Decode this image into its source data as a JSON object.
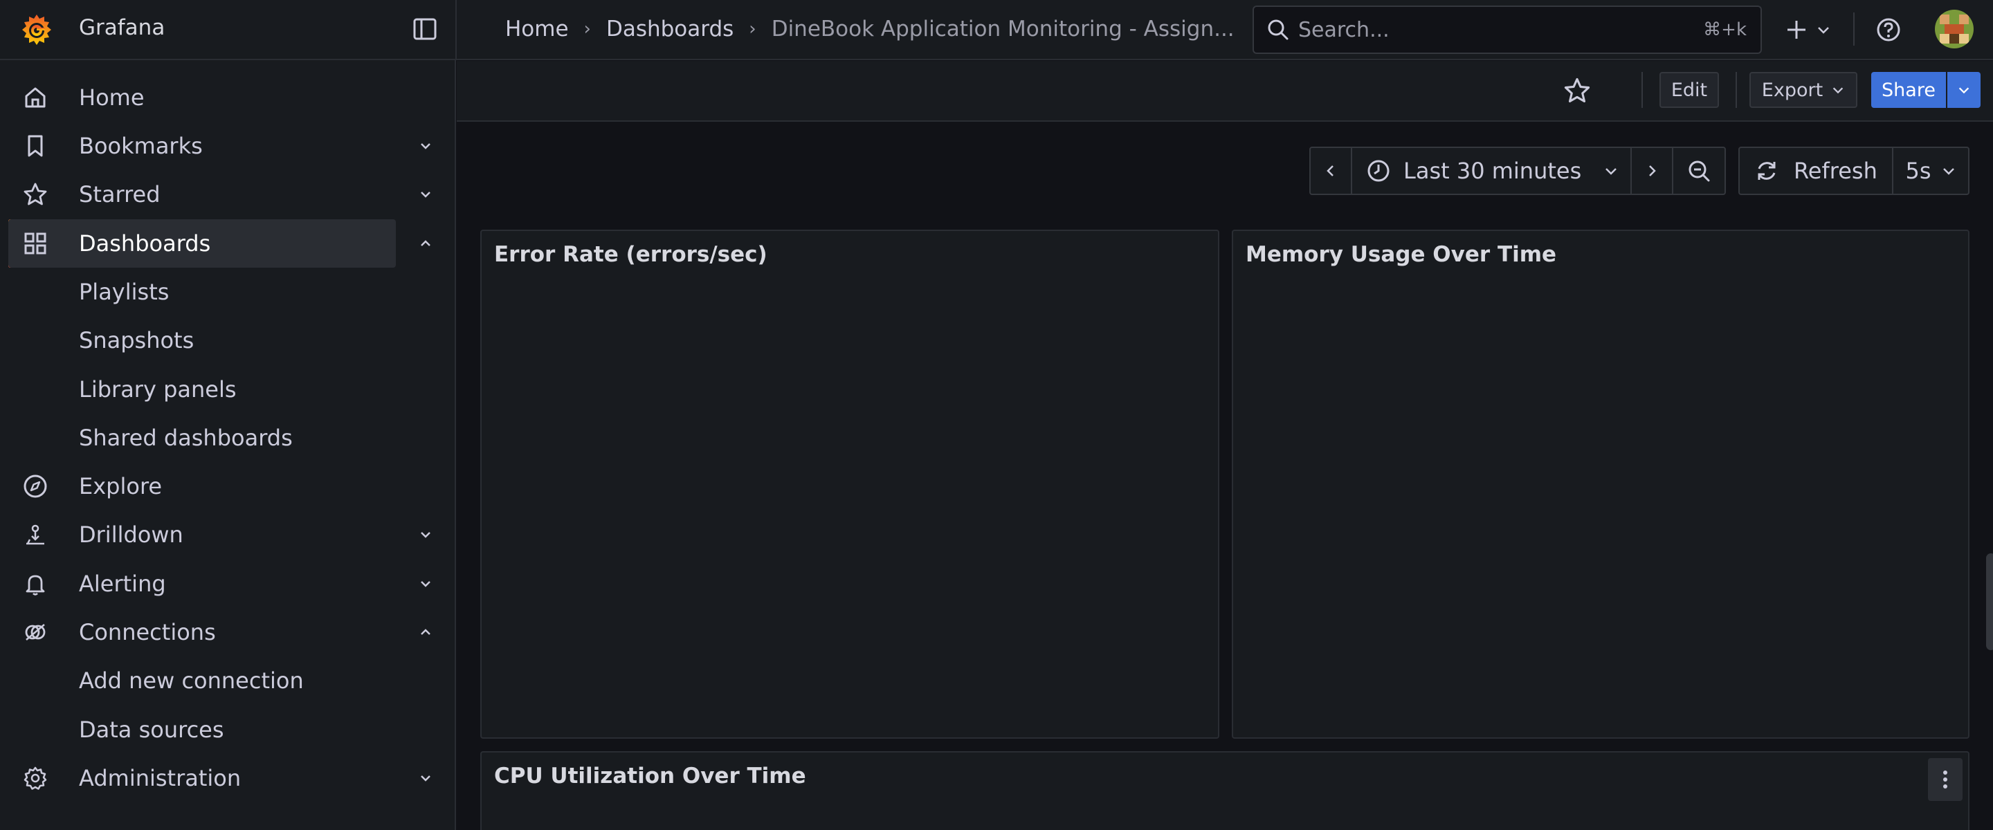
{
  "app": {
    "name": "Grafana"
  },
  "breadcrumb": {
    "items": [
      "Home",
      "Dashboards",
      "DineBook Application Monitoring - Assign..."
    ]
  },
  "search": {
    "placeholder": "Search...",
    "shortcut": "⌘+k"
  },
  "sidebar": {
    "items": [
      {
        "label": "Home",
        "icon": "home-icon",
        "chevron": "none"
      },
      {
        "label": "Bookmarks",
        "icon": "bookmark-icon",
        "chevron": "down"
      },
      {
        "label": "Starred",
        "icon": "star-icon",
        "chevron": "down"
      },
      {
        "label": "Dashboards",
        "icon": "dashboards-grid-icon",
        "chevron": "up",
        "active": true
      },
      {
        "label": "Playlists",
        "sub": true
      },
      {
        "label": "Snapshots",
        "sub": true
      },
      {
        "label": "Library panels",
        "sub": true
      },
      {
        "label": "Shared dashboards",
        "sub": true
      },
      {
        "label": "Explore",
        "icon": "compass-icon",
        "chevron": "none"
      },
      {
        "label": "Drilldown",
        "icon": "drilldown-icon",
        "chevron": "down"
      },
      {
        "label": "Alerting",
        "icon": "bell-icon",
        "chevron": "down"
      },
      {
        "label": "Connections",
        "icon": "connections-icon",
        "chevron": "up"
      },
      {
        "label": "Add new connection",
        "sub": true
      },
      {
        "label": "Data sources",
        "sub": true
      },
      {
        "label": "Administration",
        "icon": "gear-icon",
        "chevron": "down"
      }
    ]
  },
  "toolbar": {
    "edit_label": "Edit",
    "export_label": "Export",
    "share_label": "Share"
  },
  "time_controls": {
    "range_label": "Last 30 minutes",
    "refresh_label": "Refresh",
    "interval_label": "5s"
  },
  "panels": {
    "error_rate": {
      "title": "Error Rate (errors/sec)"
    },
    "memory": {
      "title": "Memory Usage Over Time"
    },
    "cpu": {
      "title": "CPU Utilization Over Time"
    }
  },
  "colors": {
    "background": "#111217",
    "surface": "#181b1f",
    "border": "#2a2d33",
    "accent_blue": "#3d71d9",
    "active_indicator": "#f55f3e",
    "text_primary": "#ccccdc",
    "text_secondary": "#9a9ba7"
  }
}
